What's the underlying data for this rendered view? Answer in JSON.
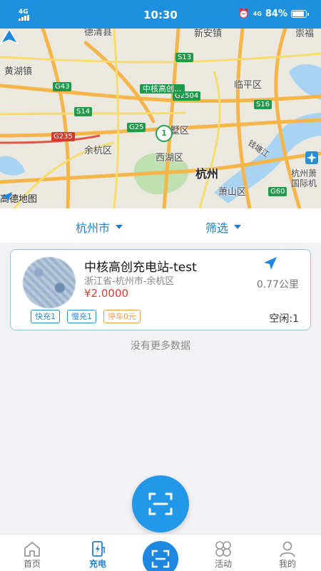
{
  "status_bar": {
    "network_left": "4G",
    "time": "10:30",
    "network_right": "4G",
    "battery": "84%"
  },
  "map": {
    "places": [
      "德清县",
      "新安镇",
      "崇福",
      "黄湖镇",
      "临平区",
      "余杭区",
      "拱墅区",
      "西湖区",
      "杭州",
      "萧山区",
      "钱塘江",
      "杭州萧",
      "国际机"
    ],
    "roads": [
      "S13",
      "G2504",
      "G43",
      "S14",
      "G25",
      "G235",
      "S16",
      "G60"
    ],
    "poi_label": "中核高创...",
    "pin_count": "1",
    "attribution": "高德地图"
  },
  "filters": {
    "city": "杭州市",
    "filter": "筛选"
  },
  "station": {
    "name": "中核高创充电站-test",
    "address": "浙江省-杭州市-余杭区",
    "price": "¥2.0000",
    "distance": "0.77公里",
    "tags": [
      "快充1",
      "慢充1",
      "停车0元"
    ],
    "idle": "空闲:1"
  },
  "no_more": "没有更多数据",
  "tabbar": {
    "items": [
      {
        "label": "首页",
        "icon": "home-icon"
      },
      {
        "label": "充电",
        "icon": "charge-icon"
      },
      {
        "label": "",
        "icon": "scan-icon"
      },
      {
        "label": "活动",
        "icon": "activity-icon"
      },
      {
        "label": "我的",
        "icon": "profile-icon"
      }
    ],
    "active": "充电"
  },
  "colors": {
    "primary": "#1e88e0",
    "price": "#e23b32",
    "tag_blue": "#2a8fd6",
    "tag_orange": "#f0a040"
  }
}
